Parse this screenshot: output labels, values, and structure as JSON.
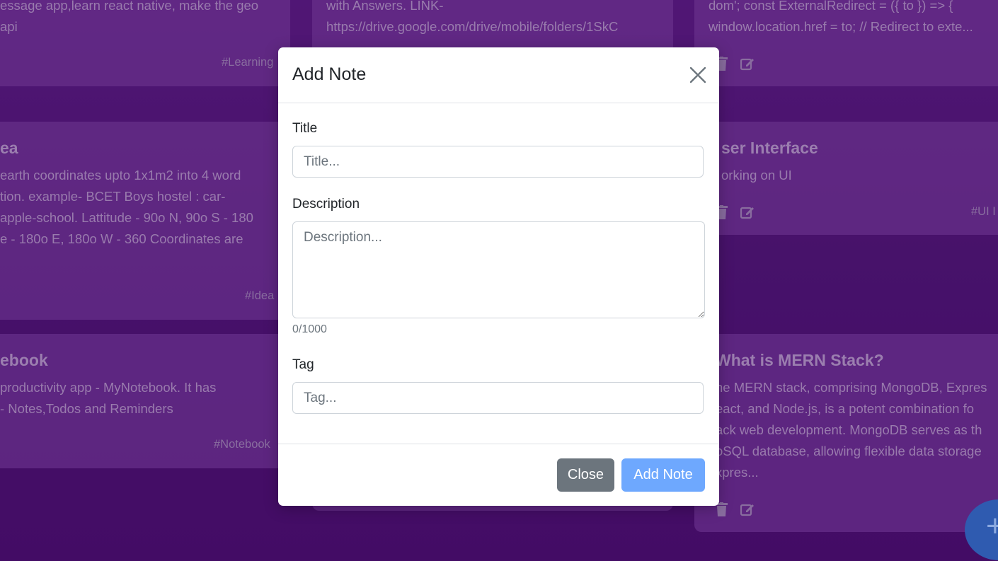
{
  "background_cards": [
    {
      "id": "learning",
      "desc": "essage app,learn react native, make the geo\napi",
      "tag": "#Learning"
    },
    {
      "id": "answers",
      "desc": "with Answers. LINK-\nhttps://drive.google.com/drive/mobile/folders/1SkC"
    },
    {
      "id": "redirect",
      "desc": "dom'; const ExternalRedirect = ({ to }) => {\nwindow.location.href = to; // Redirect to exte...",
      "tag": "#"
    },
    {
      "id": "idea",
      "title": "ea",
      "desc": "earth coordinates upto 1x1m2 into 4 word\ntion. example- BCET Boys hostel : car-\napple-school. Lattitude - 90o N, 90o S - 180\ne - 180o E, 180o W - 360 Coordinates are",
      "tag": "#Idea"
    },
    {
      "id": "ui",
      "title": "ser Interface",
      "desc": "orking on UI",
      "tag": "#UI I"
    },
    {
      "id": "notebook",
      "title": "ebook",
      "desc": "productivity app - MyNotebook. It has\n- Notes,Todos and Reminders",
      "tag": "#Notebook"
    },
    {
      "id": "mern",
      "title": "What is MERN Stack?",
      "desc": "he MERN stack, comprising MongoDB, Expres\neact, and Node.js, is a potent combination fo\nack web development. MongoDB serves as th\noSQL database, allowing flexible data storage\nxpres..."
    }
  ],
  "modal": {
    "title": "Add Note",
    "title_field": {
      "label": "Title",
      "placeholder": "Title...",
      "value": ""
    },
    "description_field": {
      "label": "Description",
      "placeholder": "Description...",
      "value": "",
      "counter": "0/1000"
    },
    "tag_field": {
      "label": "Tag",
      "placeholder": "Tag...",
      "value": ""
    },
    "close_label": "Close",
    "add_label": "Add Note"
  },
  "fab": {
    "symbol": "+"
  },
  "colors": {
    "background": "#4e1a72",
    "card": "#763a9b",
    "primary_button": "#6ea8fe",
    "secondary_button": "#6c757d"
  }
}
